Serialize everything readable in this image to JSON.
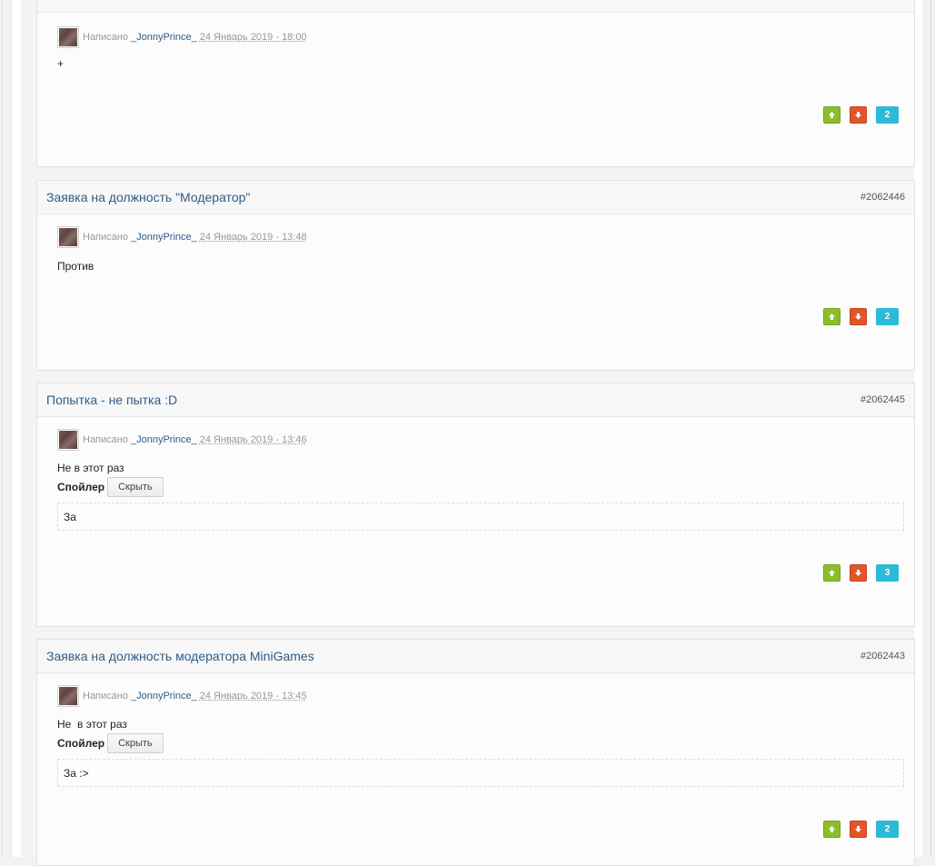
{
  "posts": [
    {
      "title": "",
      "id": "",
      "meta_label": "Написано",
      "author": "_JonnyPrince_",
      "date": "24 Январь 2019 - 18:00",
      "body": "+",
      "reputation": "2"
    },
    {
      "title": "Заявка на должность \"Модератор\"",
      "id": "#2062446",
      "meta_label": "Написано",
      "author": "_JonnyPrince_",
      "date": "24 Январь 2019 - 13:48",
      "body": "Против",
      "reputation": "2"
    },
    {
      "title": "Попытка - не пытка :D",
      "id": "#2062445",
      "meta_label": "Написано",
      "author": "_JonnyPrince_",
      "date": "24 Январь 2019 - 13:46",
      "body": "Не в этот раз",
      "spoiler_label": "Спойлер",
      "spoiler_button": "Скрыть",
      "spoiler_content": "За",
      "reputation": "3"
    },
    {
      "title": "Заявка на должность модератора MiniGames",
      "id": "#2062443",
      "meta_label": "Написано",
      "author": "_JonnyPrince_",
      "date": "24 Январь 2019 - 13:45",
      "body": "Не  в этот раз",
      "spoiler_label": "Спойлер",
      "spoiler_button": "Скрыть",
      "spoiler_content": "За :>",
      "reputation": "2"
    }
  ],
  "icons": {
    "up": "arrow-up-icon",
    "down": "arrow-down-icon"
  },
  "colors": {
    "title": "#2f5c86",
    "rep_up": "#8dbd2c",
    "rep_down": "#e0562a",
    "rep_count": "#2dbad6"
  }
}
